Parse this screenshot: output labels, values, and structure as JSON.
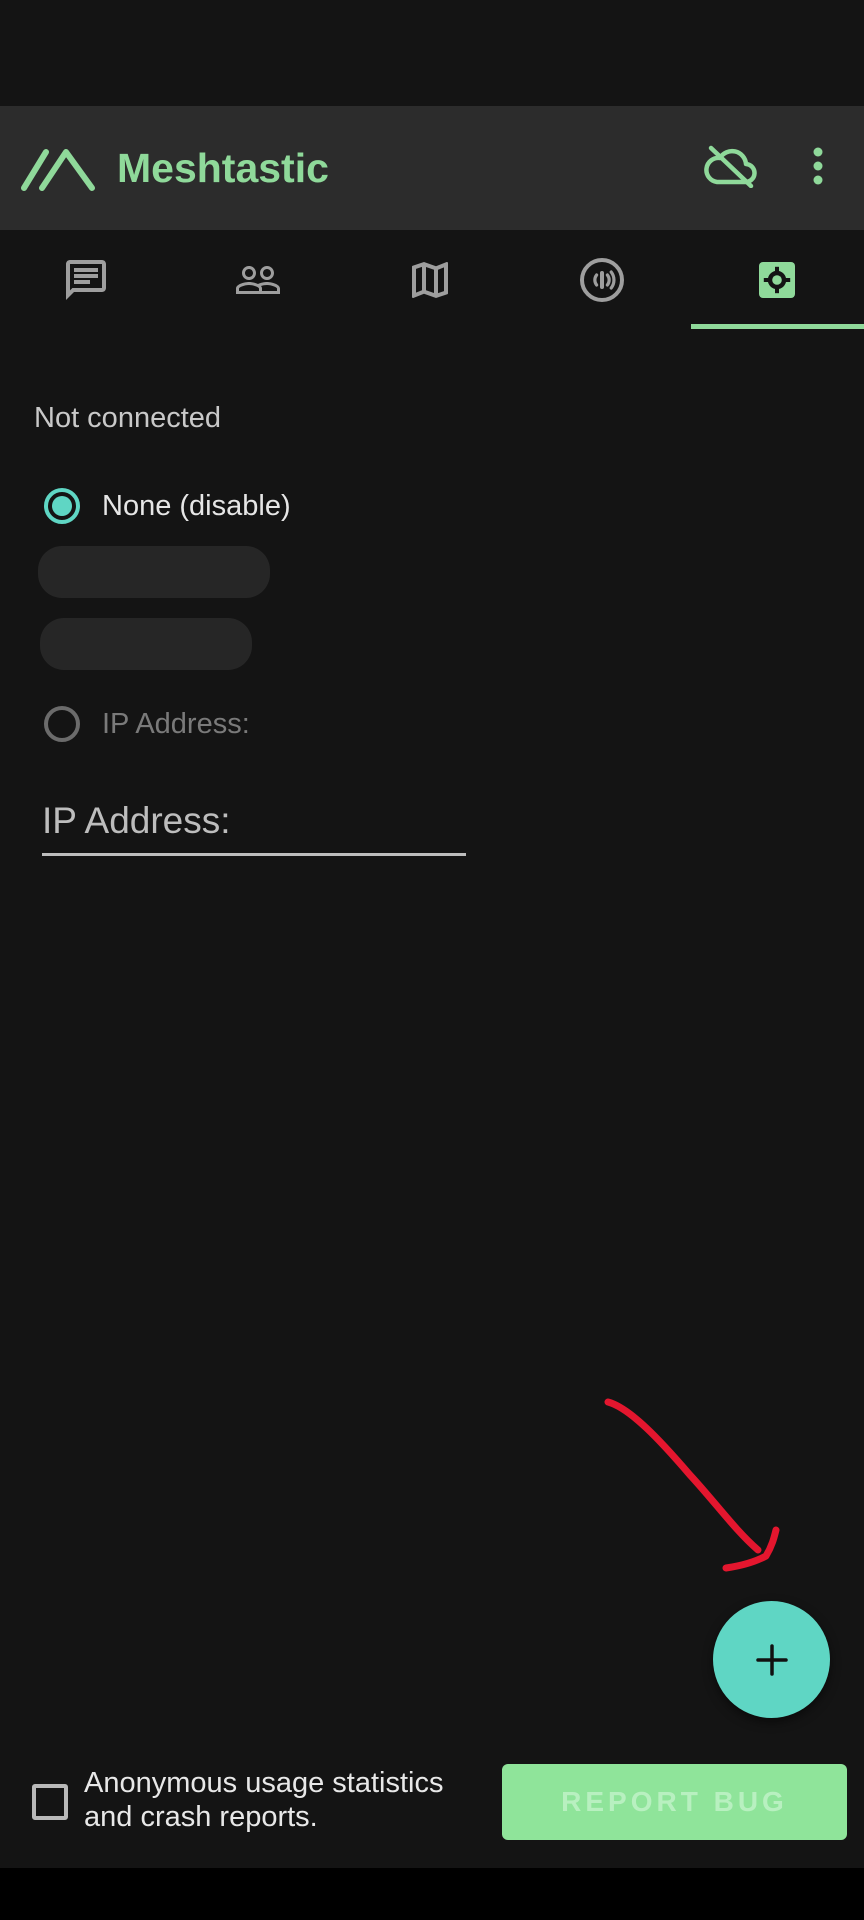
{
  "app": {
    "title": "Meshtastic",
    "accent_color": "#8fd99a",
    "teal_color": "#5fd6c4"
  },
  "app_bar": {
    "cloud_icon": "cloud-off-icon",
    "menu_icon": "more-vert-icon"
  },
  "tabs": [
    {
      "name": "messages",
      "icon": "chat-icon",
      "selected": false
    },
    {
      "name": "users",
      "icon": "people-icon",
      "selected": false
    },
    {
      "name": "map",
      "icon": "map-icon",
      "selected": false
    },
    {
      "name": "channel",
      "icon": "radio-signal-icon",
      "selected": false
    },
    {
      "name": "settings",
      "icon": "settings-icon",
      "selected": true
    }
  ],
  "connection": {
    "status": "Not connected",
    "options": [
      {
        "label": "None (disable)",
        "selected": true
      },
      {
        "label": "IP Address:",
        "selected": false
      }
    ],
    "ip_field": {
      "placeholder": "IP Address:",
      "value": ""
    }
  },
  "fab": {
    "icon": "plus-icon"
  },
  "footer": {
    "consent_label": "Anonymous usage statistics and crash reports.",
    "consent_checked": false,
    "report_bug_label": "REPORT BUG"
  }
}
